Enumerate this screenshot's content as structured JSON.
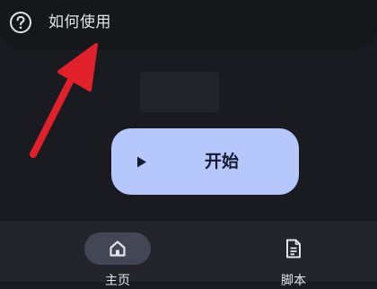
{
  "header": {
    "help_icon": "question-circle-icon",
    "help_label": "如何使用"
  },
  "main": {
    "start_button": {
      "icon": "play-icon",
      "label": "开始"
    }
  },
  "annotation": {
    "icon": "red-arrow"
  },
  "bottom_nav": {
    "items": [
      {
        "label": "主页",
        "icon": "home-icon",
        "active": true
      },
      {
        "label": "脚本",
        "icon": "document-icon",
        "active": false
      }
    ]
  },
  "colors": {
    "background": "#1a1b20",
    "header": "#16171b",
    "accent": "#b5c7fb",
    "nav": "#24252b",
    "nav_active_pill": "#434654",
    "arrow": "#e0202a"
  }
}
